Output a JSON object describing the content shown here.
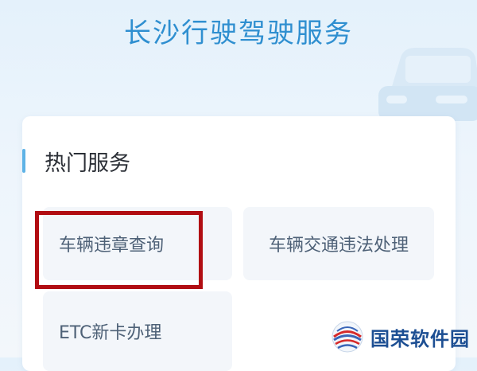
{
  "header": {
    "title": "长沙行驶驾驶服务"
  },
  "section": {
    "title": "热门服务"
  },
  "services": [
    {
      "label": "车辆违章查询"
    },
    {
      "label": "车辆交通违法处理"
    },
    {
      "label": "ETC新卡办理"
    }
  ],
  "watermark": {
    "text": "国荣软件园"
  },
  "colors": {
    "title": "#2f8fd0",
    "accent": "#5eb3e6",
    "highlight": "#b10d12",
    "service_text": "#4e6177"
  },
  "icons": {
    "background_decoration": "car-icon",
    "watermark_logo": "globe-logo-icon"
  }
}
